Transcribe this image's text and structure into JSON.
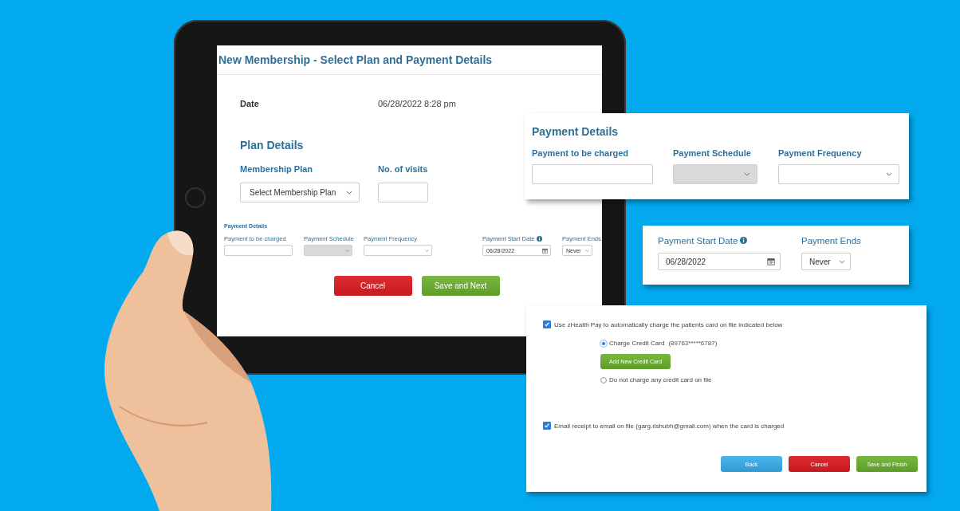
{
  "tablet_screen": {
    "title": "New Membership - Select Plan and Payment Details",
    "date_label": "Date",
    "date_value": "06/28/2022 8:28 pm",
    "plan_heading": "Plan Details",
    "plan_fields": [
      {
        "label": "Membership Plan",
        "kind": "select",
        "value": "Select Membership Plan",
        "info": false,
        "disabled": false
      },
      {
        "label": "No. of visits",
        "kind": "text",
        "info": false,
        "disabled": false
      }
    ],
    "payment_heading": "Payment Details",
    "payment_fields": [
      {
        "label": "Payment to be charged",
        "kind": "text",
        "info": false,
        "disabled": false
      },
      {
        "label": "Payment Schedule",
        "kind": "select",
        "info": false,
        "disabled": true
      },
      {
        "label": "Payment Frequency",
        "kind": "select",
        "info": false,
        "disabled": false
      },
      {
        "label": "Payment Start Date",
        "kind": "date",
        "value": "06/28/2022",
        "info": true,
        "disabled": false
      },
      {
        "label": "Payment Ends",
        "kind": "select",
        "value": "Never",
        "info": false,
        "disabled": false
      }
    ],
    "buttons": [
      {
        "label": "Cancel",
        "kind": "danger"
      },
      {
        "label": "Save and Next",
        "kind": "success"
      }
    ]
  },
  "payment_details_callout": {
    "heading": "Payment Details",
    "fields": [
      {
        "label": "Payment to be charged",
        "kind": "text",
        "info": false,
        "disabled": false
      },
      {
        "label": "Payment Schedule",
        "kind": "select",
        "info": false,
        "disabled": true
      },
      {
        "label": "Payment Frequency",
        "kind": "select",
        "info": false,
        "disabled": false
      }
    ]
  },
  "start_date_callout": {
    "fields": [
      {
        "label": "Payment Start Date",
        "kind": "date",
        "value": "06/28/2022",
        "info": true,
        "disabled": false
      },
      {
        "label": "Payment Ends",
        "kind": "select",
        "value": "Never",
        "info": false,
        "disabled": false
      }
    ]
  },
  "zhealth_pay_callout": {
    "auto_charge": {
      "label": "Use zHealth Pay to automatically charge the patients card on file indicated below",
      "checked": true
    },
    "card_options": [
      {
        "label": "Charge Credit Card",
        "detail": "(89763*****6787)",
        "selected": true
      },
      {
        "label": "Do not charge any credit card on file",
        "selected": false
      }
    ],
    "add_card_button": "Add New Credit Card",
    "email_receipt": {
      "label": "Email receipt to email on file (garg.rishubh@gmail.com) when the card is charged",
      "checked": true
    },
    "buttons": [
      {
        "label": "Back",
        "kind": "primary"
      },
      {
        "label": "Cancel",
        "kind": "danger"
      },
      {
        "label": "Save and Finish",
        "kind": "success"
      }
    ]
  }
}
